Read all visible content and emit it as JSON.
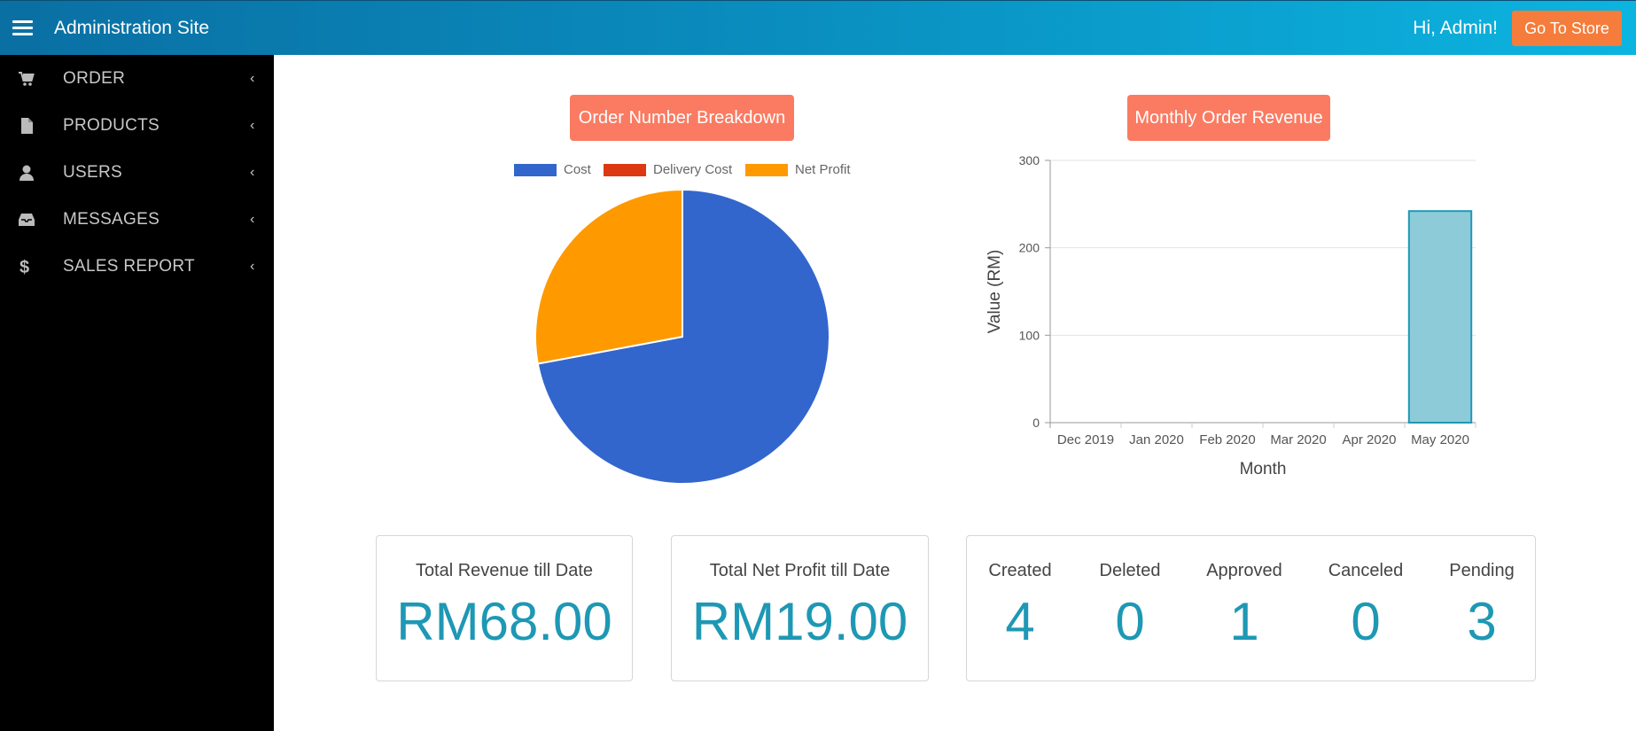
{
  "header": {
    "app_title": "Administration Site",
    "greeting": "Hi, Admin!",
    "store_button": "Go To Store",
    "bg_gradient": [
      "#0a6fa3",
      "#0cb4e0"
    ],
    "store_button_color": "#f57c3a"
  },
  "sidebar": {
    "items": [
      {
        "label": "ORDER",
        "icon": "cart-icon"
      },
      {
        "label": "PRODUCTS",
        "icon": "file-icon"
      },
      {
        "label": "USERS",
        "icon": "user-icon"
      },
      {
        "label": "MESSAGES",
        "icon": "inbox-icon"
      },
      {
        "label": "SALES REPORT",
        "icon": "dollar-icon"
      }
    ]
  },
  "charts": {
    "pie_title": "Order Number Breakdown",
    "bar_title": "Monthly Order Revenue"
  },
  "chart_data": [
    {
      "type": "pie",
      "title": "Order Number Breakdown",
      "labels": [
        "Cost",
        "Delivery Cost",
        "Net Profit"
      ],
      "values": [
        49,
        0,
        19
      ],
      "colors": [
        "#3366cc",
        "#dc3912",
        "#ff9900"
      ],
      "legend": "top"
    },
    {
      "type": "bar",
      "title": "Monthly Order Revenue",
      "categories": [
        "Dec 2019",
        "Jan 2020",
        "Feb 2020",
        "Mar 2020",
        "Apr 2020",
        "May 2020"
      ],
      "values": [
        0,
        0,
        0,
        0,
        0,
        242
      ],
      "xlabel": "Month",
      "ylabel": "Value (RM)",
      "ylim": [
        0,
        300
      ],
      "yticks": [
        0,
        100,
        200,
        300
      ],
      "grid": true,
      "bar_color": "#8ecbd9",
      "bar_border": "#1e98b4"
    }
  ],
  "stats": {
    "revenue_label": "Total Revenue till Date",
    "revenue_value": "RM68.00",
    "profit_label": "Total Net Profit till Date",
    "profit_value": "RM19.00",
    "orders": [
      {
        "label": "Created",
        "value": "4"
      },
      {
        "label": "Deleted",
        "value": "0"
      },
      {
        "label": "Approved",
        "value": "1"
      },
      {
        "label": "Canceled",
        "value": "0"
      },
      {
        "label": "Pending",
        "value": "3"
      }
    ]
  }
}
